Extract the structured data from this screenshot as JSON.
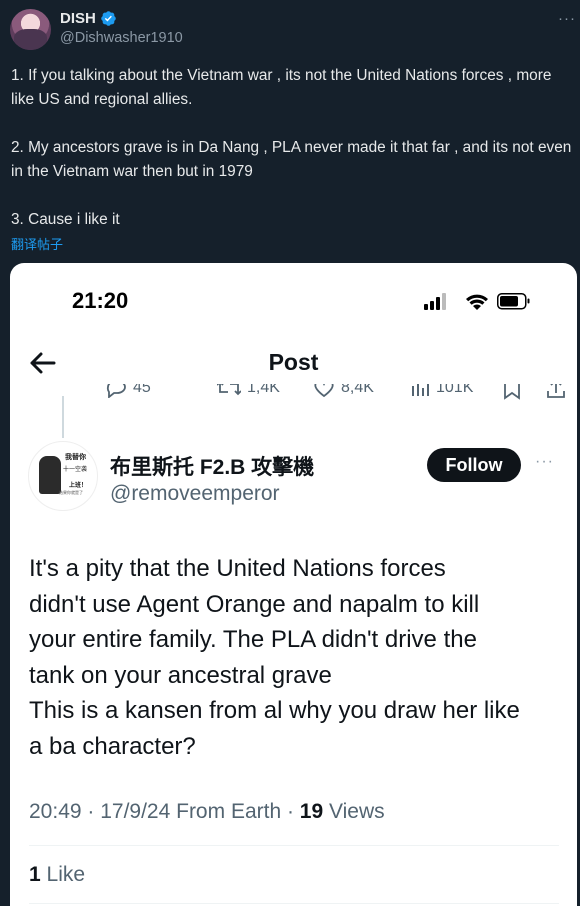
{
  "outer_tweet": {
    "display_name": "DISH",
    "handle": "@Dishwasher1910",
    "more_label": "···",
    "paragraphs": [
      "1. If you talking about the Vietnam war , its not the United Nations forces , more like US and regional allies.",
      "2. My ancestors grave is in Da Nang , PLA never made it that far , and its not even in the Vietnam war then but in 1979",
      "3. Cause i like it"
    ],
    "translate_label": "翻译帖子"
  },
  "embedded_screenshot": {
    "status_time": "21:20",
    "nav_title": "Post",
    "action_counts": [
      "45",
      "1,4K",
      "8,4K",
      "101K"
    ],
    "quoted_tweet": {
      "display_name": "布里斯托 F2.B 攻擊機",
      "handle": "@removeemperor",
      "follow_label": "Follow",
      "more_label": "···",
      "avatar_text": [
        "我替你",
        "十一空袭",
        "上班！",
        "结果你就是了"
      ],
      "text_lines": [
        "It's a pity that the United Nations forces",
        "didn't use Agent Orange and napalm to kill",
        "your entire family. The PLA didn't drive the",
        "tank on your ancestral grave",
        "This is a kansen from al why you draw her like",
        "a ba character?"
      ],
      "timestamp": "20:49 · 17/9/24 From Earth · ",
      "views_count": "19",
      "views_label": " Views",
      "likes_count": "1",
      "likes_label": " Like"
    }
  },
  "colors": {
    "background": "#15202b",
    "accent": "#1d9bf0",
    "text_primary": "#e7e9ea",
    "text_secondary": "#8b98a5"
  }
}
